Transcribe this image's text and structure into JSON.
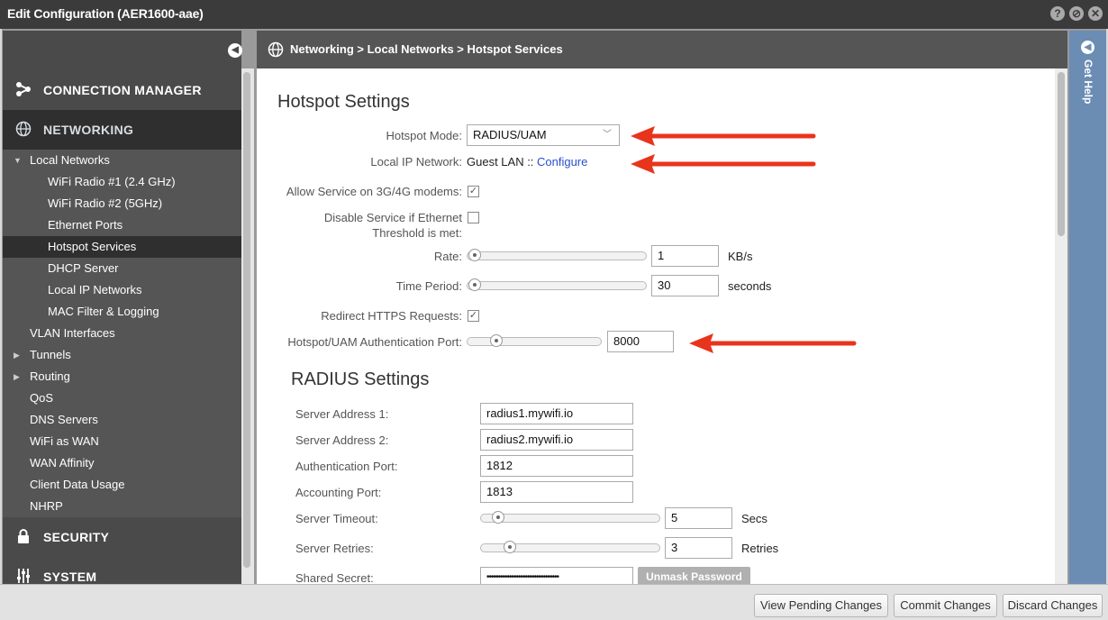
{
  "window": {
    "title": "Edit Configuration (AER1600-aae)"
  },
  "sidebar": {
    "sections": [
      {
        "label": "CONNECTION MANAGER",
        "icon": "connection-icon"
      },
      {
        "label": "NETWORKING",
        "icon": "globe-icon"
      },
      {
        "label": "SECURITY",
        "icon": "lock-icon"
      },
      {
        "label": "SYSTEM",
        "icon": "sliders-icon"
      }
    ],
    "items": [
      {
        "label": "Local Networks",
        "expanded": true
      },
      {
        "label": "WiFi Radio #1 (2.4 GHz)"
      },
      {
        "label": "WiFi Radio #2 (5GHz)"
      },
      {
        "label": "Ethernet Ports"
      },
      {
        "label": "Hotspot Services",
        "selected": true
      },
      {
        "label": "DHCP Server"
      },
      {
        "label": "Local IP Networks"
      },
      {
        "label": "MAC Filter & Logging"
      },
      {
        "label": "VLAN Interfaces"
      },
      {
        "label": "Tunnels",
        "expandable": true
      },
      {
        "label": "Routing",
        "expandable": true
      },
      {
        "label": "QoS"
      },
      {
        "label": "DNS Servers"
      },
      {
        "label": "WiFi as WAN"
      },
      {
        "label": "WAN Affinity"
      },
      {
        "label": "Client Data Usage"
      },
      {
        "label": "NHRP"
      }
    ]
  },
  "breadcrumb": "Networking > Local Networks > Hotspot Services",
  "help": {
    "label": "Get Help"
  },
  "hotspot": {
    "heading": "Hotspot Settings",
    "mode_label": "Hotspot Mode:",
    "mode_value": "RADIUS/UAM",
    "local_ip_label": "Local IP Network:",
    "local_ip_value": "Guest LAN ::",
    "configure_link": "Configure",
    "allow_3g4g_label": "Allow Service on 3G/4G modems:",
    "allow_3g4g_checked": true,
    "disable_eth_label_1": "Disable Service if Ethernet",
    "disable_eth_label_2": "Threshold is met:",
    "disable_eth_checked": false,
    "rate_label": "Rate:",
    "rate_value": "1",
    "rate_unit": "KB/s",
    "time_period_label": "Time Period:",
    "time_period_value": "30",
    "time_period_unit": "seconds",
    "redirect_https_label": "Redirect HTTPS Requests:",
    "redirect_https_checked": true,
    "auth_port_label": "Hotspot/UAM Authentication Port:",
    "auth_port_value": "8000"
  },
  "radius": {
    "heading": "RADIUS Settings",
    "server1_label": "Server Address 1:",
    "server1_value": "radius1.mywifi.io",
    "server2_label": "Server Address 2:",
    "server2_value": "radius2.mywifi.io",
    "auth_port_label": "Authentication Port:",
    "auth_port_value": "1812",
    "acct_port_label": "Accounting Port:",
    "acct_port_value": "1813",
    "timeout_label": "Server Timeout:",
    "timeout_value": "5",
    "timeout_unit": "Secs",
    "retries_label": "Server Retries:",
    "retries_value": "3",
    "retries_unit": "Retries",
    "secret_label": "Shared Secret:",
    "secret_value": "••••••••••••••••••••••••••••••••",
    "unmask_label": "Unmask Password"
  },
  "footer": {
    "view_pending": "View Pending Changes",
    "commit": "Commit Changes",
    "discard": "Discard Changes"
  },
  "colors": {
    "arrow": "#e8341c",
    "link": "#2a4fd0",
    "help_bar": "#6b8cb3"
  }
}
